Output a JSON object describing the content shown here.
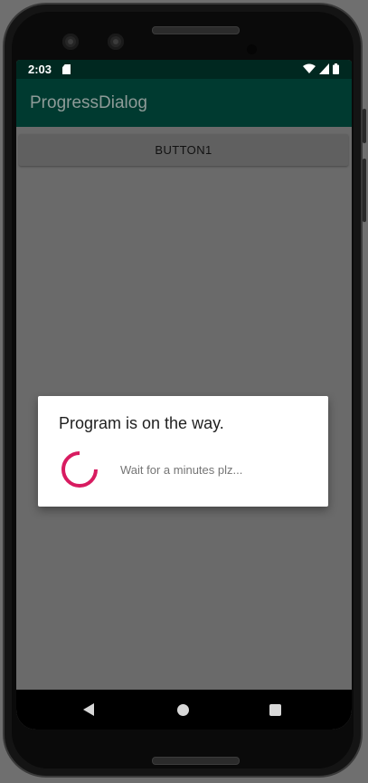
{
  "status_bar": {
    "time": "2:03",
    "icons": [
      "sd-card-icon",
      "wifi-icon",
      "signal-icon",
      "battery-icon"
    ]
  },
  "app_bar": {
    "title": "ProgressDialog"
  },
  "main": {
    "button1_label": "BUTTON1"
  },
  "dialog": {
    "title": "Program is on the way.",
    "message": "Wait for a minutes plz...",
    "spinner_color": "#d81b60"
  },
  "nav_bar": {
    "icons": [
      "back-icon",
      "home-icon",
      "recents-icon"
    ]
  },
  "colors": {
    "status_bar": "#002820",
    "app_bar": "#003a30",
    "scrim_background": "#6a6a6a",
    "accent": "#d81b60"
  }
}
